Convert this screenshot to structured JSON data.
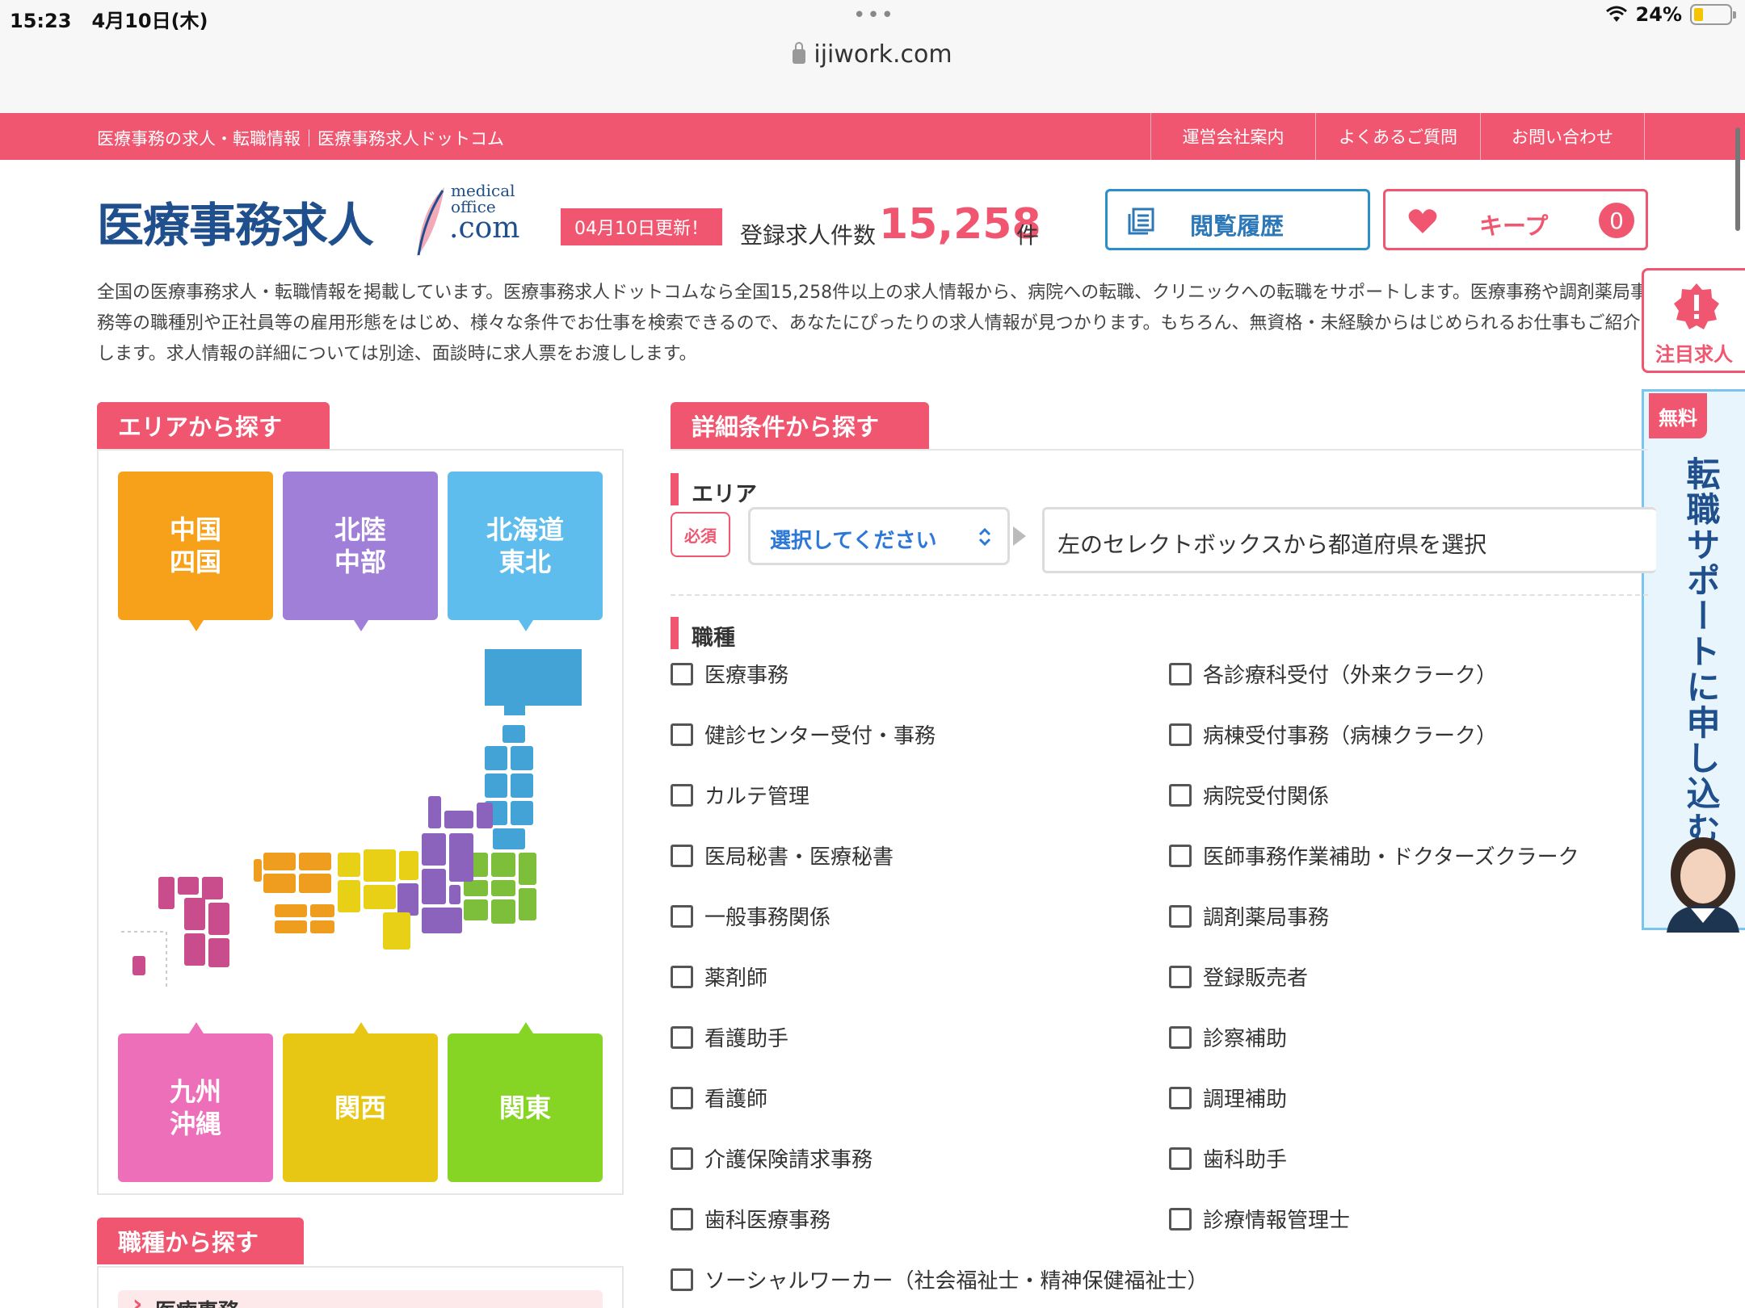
{
  "status": {
    "time": "15:23",
    "date": "4月10日(木)",
    "battery": "24%",
    "url": "ijiwork.com"
  },
  "topbar": {
    "title": "医療事務の求人・転職情報｜医療事務求人ドットコム",
    "nav": [
      "運営会社案内",
      "よくあるご質問",
      "お問い合わせ"
    ]
  },
  "header": {
    "logo_main": "医療事務求人",
    "logo_medical": "medical",
    "logo_office": "office",
    "logo_com": ".com",
    "update_badge": "04月10日更新！",
    "count_label": "登録求人件数",
    "count_value": "15,258",
    "count_unit": "件",
    "history_label": "閲覧履歴",
    "keep_label": "キープ",
    "keep_count": "0"
  },
  "intro": "全国の医療事務求人・転職情報を掲載しています。医療事務求人ドットコムなら全国15,258件以上の求人情報から、病院への転職、クリニックへの転職をサポートします。医療事務や調剤薬局事務等の職種別や正社員等の雇用形態をはじめ、様々な条件でお仕事を検索できるので、あなたにぴったりの求人情報が見つかります。もちろん、無資格・未経験からはじめられるお仕事もご紹介します。求人情報の詳細については別途、面談時に求人票をお渡しします。",
  "float": {
    "attention_label": "注目求人",
    "free_label": "無料",
    "support_text": "転職サポートに申し込む"
  },
  "area": {
    "title": "エリアから探す",
    "regions_top": [
      {
        "line1": "中国",
        "line2": "四国",
        "color": "#f7a11a"
      },
      {
        "line1": "北陸",
        "line2": "中部",
        "color": "#a07fd8"
      },
      {
        "line1": "北海道",
        "line2": "東北",
        "color": "#5fbdee"
      }
    ],
    "regions_bottom": [
      {
        "line1": "九州",
        "line2": "沖縄",
        "color": "#ee6fb9"
      },
      {
        "line1": "関西",
        "line2": "",
        "color": "#e8c714"
      },
      {
        "line1": "関東",
        "line2": "",
        "color": "#86d424"
      }
    ]
  },
  "jobs_section": {
    "title": "職種から探す",
    "first_item": "医療事務"
  },
  "detail": {
    "title": "詳細条件から探す",
    "area_label": "エリア",
    "required": "必須",
    "select_placeholder": "選択してください",
    "pref_hint": "左のセレクトボックスから都道府県を選択",
    "job_label": "職種",
    "jobs_left": [
      "医療事務",
      "健診センター受付・事務",
      "カルテ管理",
      "医局秘書・医療秘書",
      "一般事務関係",
      "薬剤師",
      "看護助手",
      "看護師",
      "介護保険請求事務",
      "歯科医療事務",
      "ソーシャルワーカー（社会福祉士・精神保健福祉士）"
    ],
    "jobs_right": [
      "各診療科受付（外来クラーク）",
      "病棟受付事務（病棟クラーク）",
      "病院受付関係",
      "医師事務作業補助・ドクターズクラーク",
      "調剤薬局事務",
      "登録販売者",
      "診察補助",
      "調理補助",
      "歯科助手",
      "診療情報管理士"
    ]
  }
}
